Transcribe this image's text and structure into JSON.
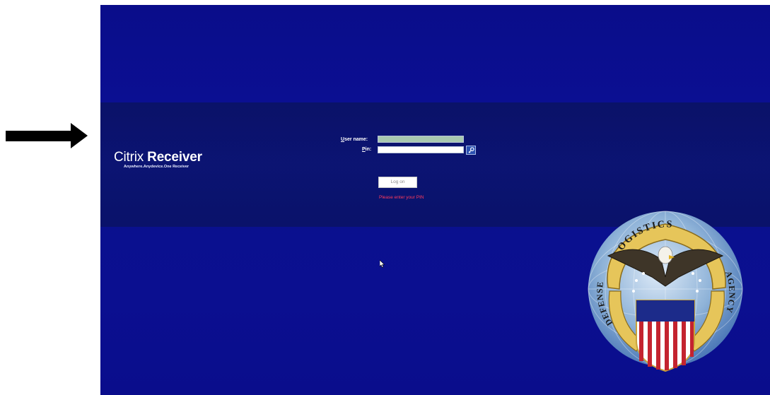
{
  "brand": {
    "name_light": "Citrix",
    "name_bold": "Receiver",
    "tagline": "Anywhere.Anydevice.One Receiver"
  },
  "form": {
    "username_label_underlined": "U",
    "username_label_rest": "ser name:",
    "username_value": "",
    "pin_label_underlined": "P",
    "pin_label_rest": "in:",
    "pin_value": "",
    "logon_button": "Log on",
    "error_message": "Please enter your PIN"
  },
  "seal": {
    "arc_text": "DEFENSE LOGISTICS AGENCY"
  },
  "colors": {
    "background": "#0a0d8a",
    "error": "#ff3b5c",
    "page": "#ffffff"
  },
  "icons": {
    "annotation": "arrow-right-icon",
    "pin_button": "key-icon",
    "pointer": "mouse-cursor-icon"
  }
}
